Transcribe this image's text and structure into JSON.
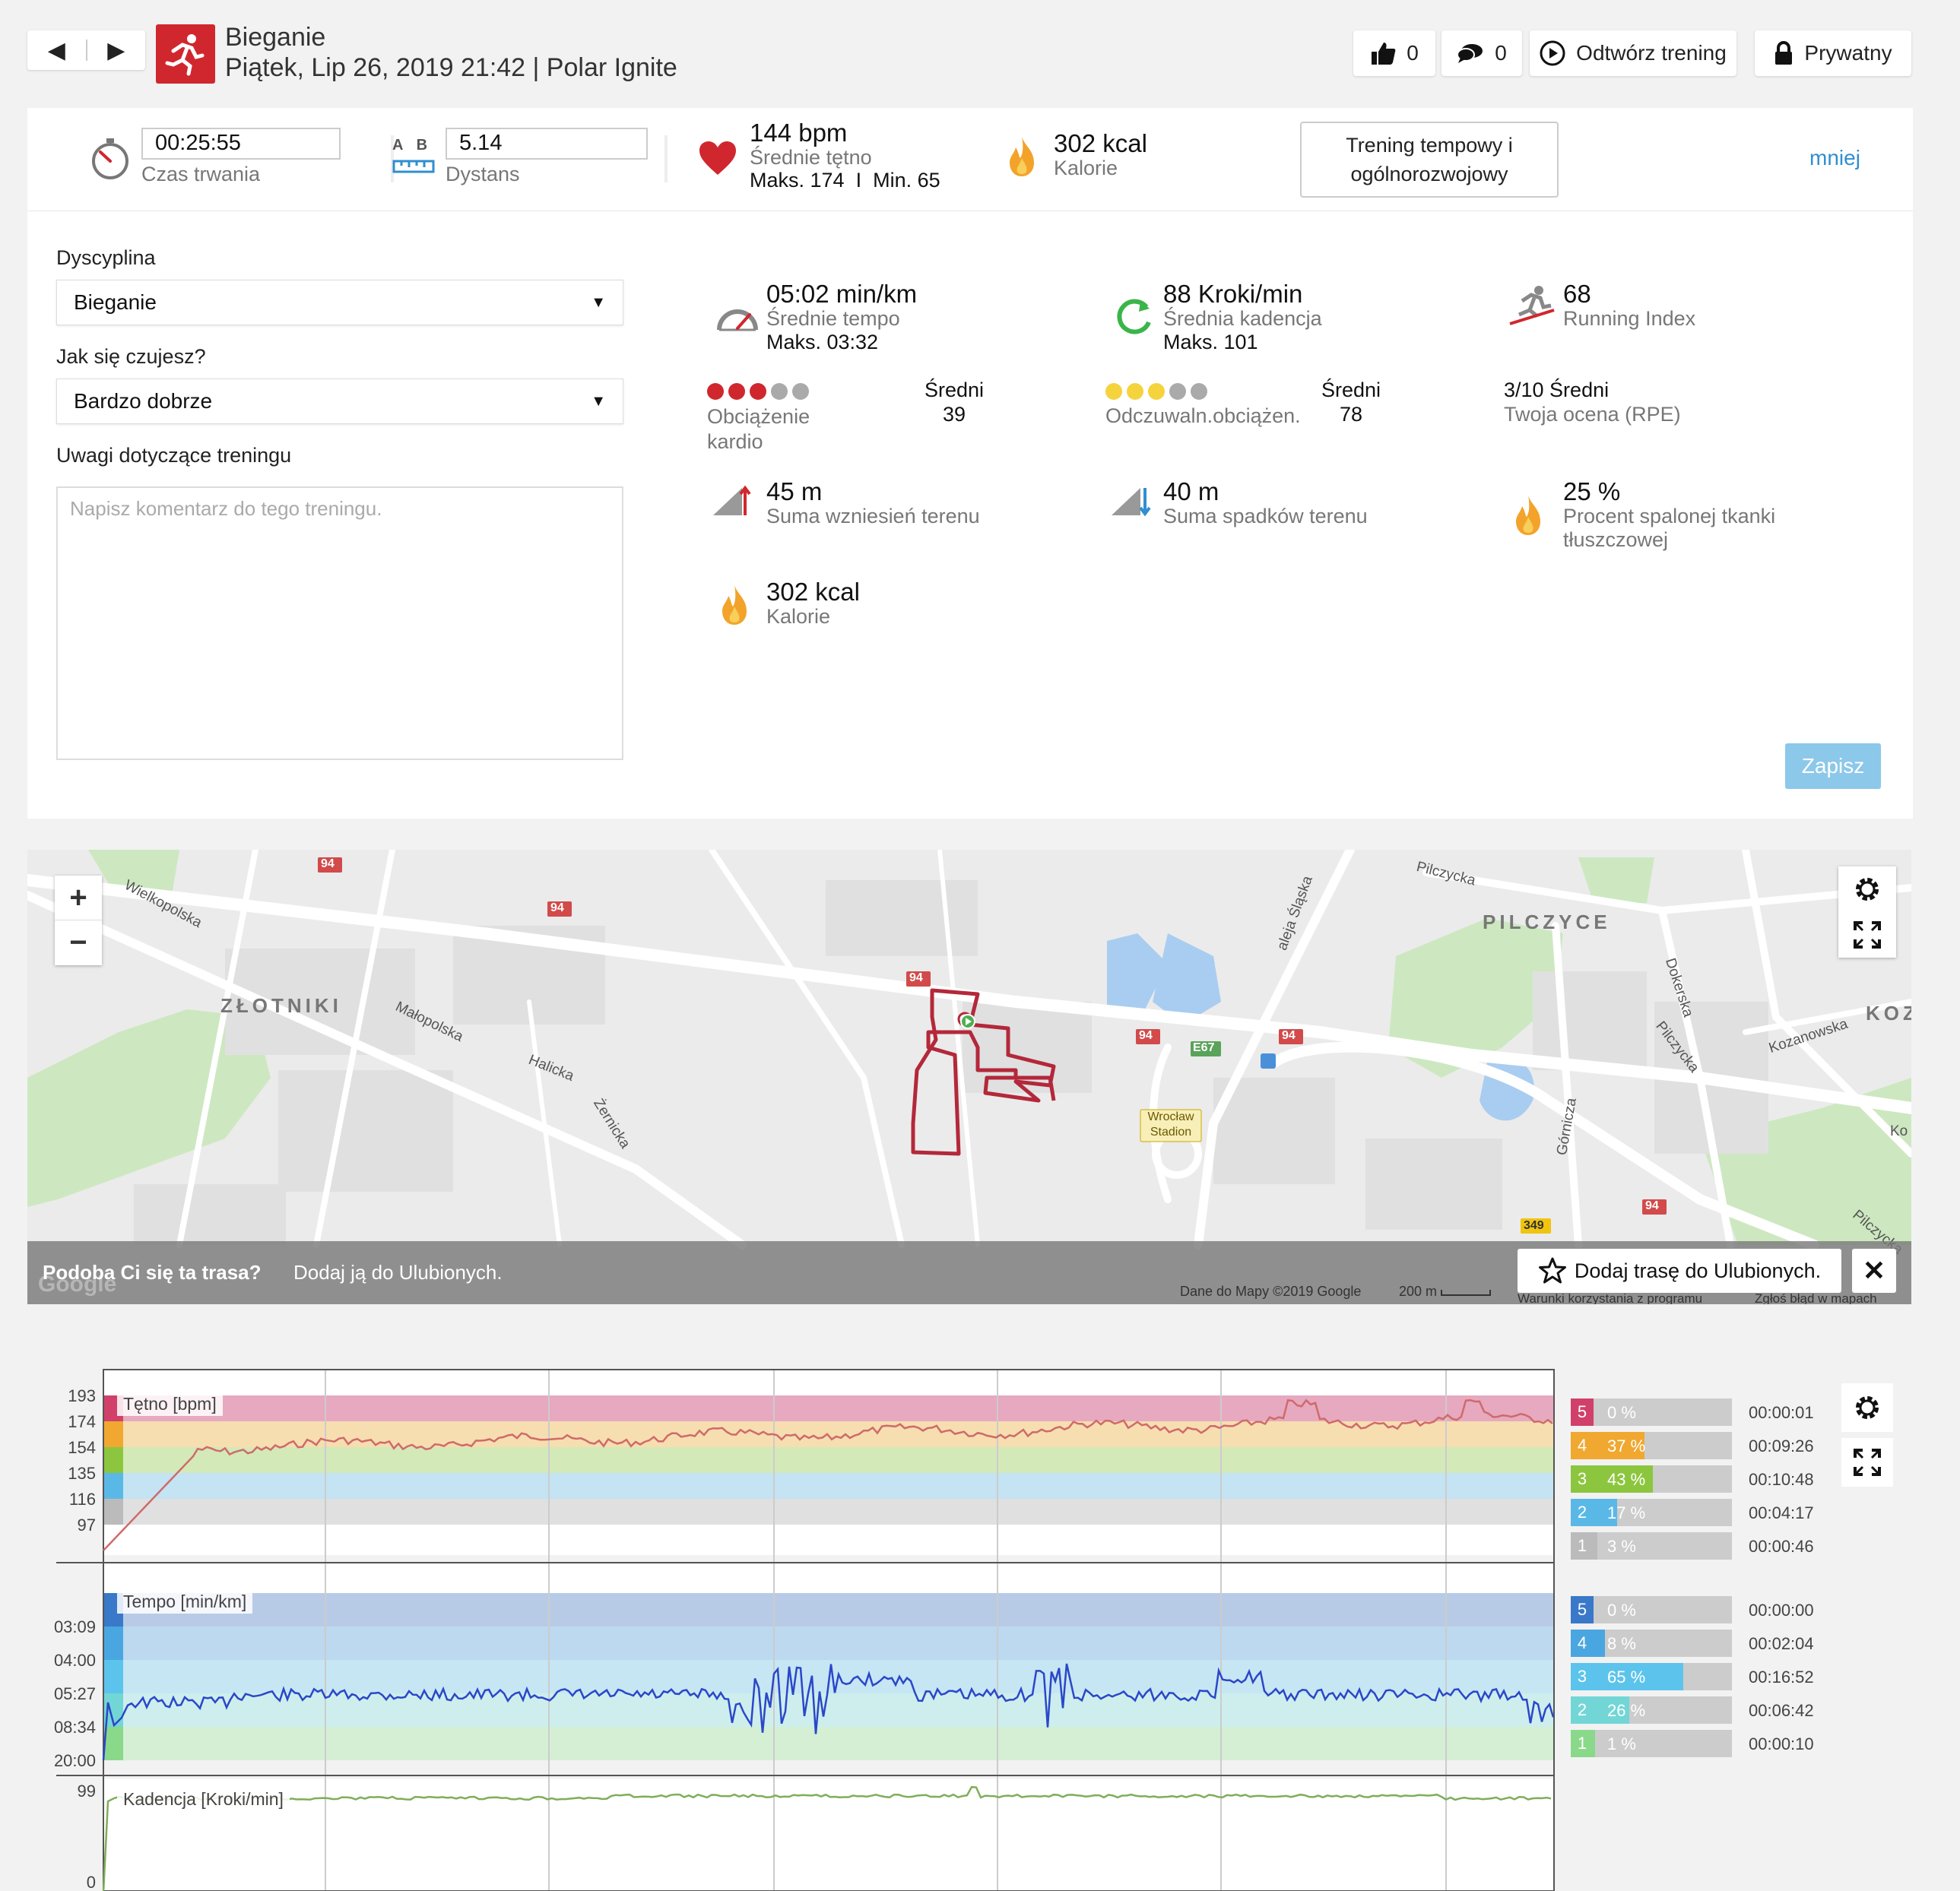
{
  "header": {
    "sport": "Bieganie",
    "date_device": "Piątek, Lip 26, 2019 21:42 | Polar Ignite",
    "likes": "0",
    "comments": "0",
    "replay_label": "Odtwórz trening",
    "privacy_label": "Prywatny"
  },
  "summary": {
    "duration_value": "00:25:55",
    "duration_label": "Czas trwania",
    "distance_value": "5.14",
    "distance_label": "Dystans",
    "ab_a": "A",
    "ab_b": "B",
    "hr_value": "144 bpm",
    "hr_label": "Średnie tętno",
    "hr_max": "Maks. 174",
    "hr_min": "Min. 65",
    "hr_sep": "I",
    "kcal_value": "302 kcal",
    "kcal_label": "Kalorie",
    "benefit": "Trening tempowy i ogólnorozwojowy",
    "less_link": "mniej"
  },
  "form": {
    "discipline_label": "Dyscyplina",
    "discipline_value": "Bieganie",
    "feeling_label": "Jak się czujesz?",
    "feeling_value": "Bardzo dobrze",
    "notes_label": "Uwagi dotyczące treningu",
    "notes_placeholder": "Napisz komentarz do tego treningu.",
    "save_label": "Zapisz"
  },
  "metrics": {
    "pace_value": "05:02 min/km",
    "pace_label": "Średnie tempo",
    "pace_max": "Maks. 03:32",
    "cadence_value": "88 Kroki/min",
    "cadence_label": "Średnia kadencja",
    "cadence_max": "Maks. 101",
    "ri_value": "68",
    "ri_label": "Running Index",
    "cardio_label": "Obciążenie kardio",
    "cardio_level": "Średni",
    "cardio_value": "39",
    "cardio_dots": 3,
    "perceived_label": "Odczuwaln.obciążen.",
    "perceived_level": "Średni",
    "perceived_value": "78",
    "perceived_dots": 3,
    "rpe_value": "3/10 Średni",
    "rpe_label": "Twoja ocena (RPE)",
    "ascent_value": "45 m",
    "ascent_label": "Suma wzniesień terenu",
    "descent_value": "40 m",
    "descent_label": "Suma spadków terenu",
    "fat_value": "25 %",
    "fat_label": "Procent spalonej tkanki tłuszczowej",
    "kcal_value": "302 kcal",
    "kcal_label": "Kalorie"
  },
  "map": {
    "labels": {
      "zlotniki": "ZŁOTNIKI",
      "pilczyce": "PILCZYCE",
      "koz": "KOZ",
      "wielkopolska": "Wielkopolska",
      "malopolska": "Małopolska",
      "halicka": "Halicka",
      "zernicka": "Żernicka",
      "pilczycka_top": "Pilczycka",
      "pilczycka_right": "Pilczycka",
      "pilczycka_bottom": "Pilczycka",
      "aleja": "aleja Śląska",
      "dokerska": "Dokerska",
      "kozanowska": "Kozanowska",
      "gornicza": "Górnicza",
      "ko": "Ko",
      "stadion": "Wrocław Stadion",
      "r94": "94",
      "e67": "E67",
      "r349": "349"
    },
    "banner_question": "Podoba Ci się ta trasa?",
    "banner_text": "Dodaj ją do Ulubionych.",
    "fav_button": "Dodaj trasę do Ulubionych.",
    "attribution": "Dane do Mapy ©2019 Google",
    "scale": "200 m",
    "terms": "Warunki korzystania z programu",
    "report": "Zgłoś błąd w mapach",
    "google": "Google",
    "zoom_in": "+",
    "zoom_out": "−"
  },
  "charts": {
    "hr": {
      "title": "Tętno [bpm]",
      "ticks": [
        "193",
        "174",
        "154",
        "135",
        "116",
        "97"
      ],
      "zones": [
        {
          "num": "5",
          "pct": "0 %",
          "frac": 0.0,
          "time": "00:00:01",
          "color": "#d0406a",
          "bg": "#e6a9c0"
        },
        {
          "num": "4",
          "pct": "37 %",
          "frac": 0.37,
          "time": "00:09:26",
          "color": "#f0a830",
          "bg": "#f6deb0"
        },
        {
          "num": "3",
          "pct": "43 %",
          "frac": 0.43,
          "time": "00:10:48",
          "color": "#8cc63f",
          "bg": "#d4e9b8"
        },
        {
          "num": "2",
          "pct": "17 %",
          "frac": 0.17,
          "time": "00:04:17",
          "color": "#5ab8e6",
          "bg": "#c4e3f3"
        },
        {
          "num": "1",
          "pct": "3 %",
          "frac": 0.03,
          "time": "00:00:46",
          "color": "#bbbbbb",
          "bg": "#e0e0e0"
        }
      ]
    },
    "pace": {
      "title": "Tempo [min/km]",
      "ticks": [
        "03:09",
        "04:00",
        "05:27",
        "08:34",
        "20:00"
      ],
      "zones": [
        {
          "num": "5",
          "pct": "0 %",
          "frac": 0.0,
          "time": "00:00:00",
          "color": "#3a78c9",
          "bg": "#b8cbe6"
        },
        {
          "num": "4",
          "pct": "8 %",
          "frac": 0.08,
          "time": "00:02:04",
          "color": "#4aa6e0",
          "bg": "#bcd9ef"
        },
        {
          "num": "3",
          "pct": "65 %",
          "frac": 0.65,
          "time": "00:16:52",
          "color": "#5cc4ec",
          "bg": "#c6e6f4"
        },
        {
          "num": "2",
          "pct": "26 %",
          "frac": 0.26,
          "time": "00:06:42",
          "color": "#73d6d6",
          "bg": "#cdeeed"
        },
        {
          "num": "1",
          "pct": "1 %",
          "frac": 0.01,
          "time": "00:00:10",
          "color": "#8ad98a",
          "bg": "#d4efd4"
        }
      ]
    },
    "cadence": {
      "title": "Kadencja [Kroki/min]",
      "ticks": [
        "99",
        "0"
      ]
    }
  },
  "colors": {
    "accent": "#d0272e",
    "link": "#2f8fd0",
    "save": "#8cc8ea",
    "route": "#b3283a",
    "hr_line": "#d06a6a",
    "pace_line": "#2b47c8",
    "cad_line": "#7fae5a"
  },
  "icons": [
    "prev-icon",
    "next-icon",
    "running-icon",
    "thumbs-up-icon",
    "comment-icon",
    "play-icon",
    "lock-icon",
    "stopwatch-icon",
    "distance-icon",
    "heart-icon",
    "flame-icon",
    "gauge-icon",
    "cadence-icon",
    "running-index-icon",
    "ascent-icon",
    "descent-icon",
    "gear-icon",
    "fullscreen-icon",
    "star-icon",
    "close-icon"
  ]
}
